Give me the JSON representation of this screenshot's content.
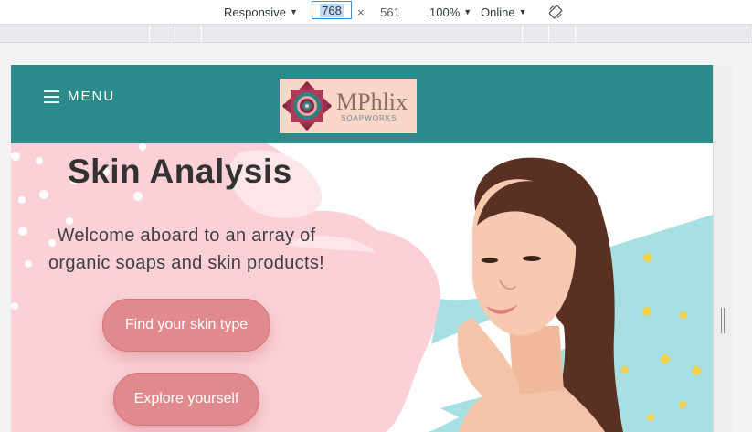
{
  "devtools": {
    "device": "Responsive",
    "width": "768",
    "times": "×",
    "height": "561",
    "zoom": "100%",
    "throttle": "Online",
    "rotate_icon": "rotate-icon"
  },
  "site": {
    "menu_label": "MENU",
    "logo": {
      "name": "MPhlix",
      "sub": "SOAPWORKS"
    },
    "hero": {
      "title": "Skin Analysis",
      "tagline": "Welcome aboard to an array of organic soaps and skin products!",
      "primary_button": "Find your skin type",
      "secondary_button": "Explore yourself"
    }
  },
  "colors": {
    "header_teal": "#2b8a8a",
    "button_pink": "#e18a8d",
    "blob_pink": "#fbd1d7",
    "splash_teal": "#a7e0e2",
    "dots_yellow": "#f6d04a"
  }
}
